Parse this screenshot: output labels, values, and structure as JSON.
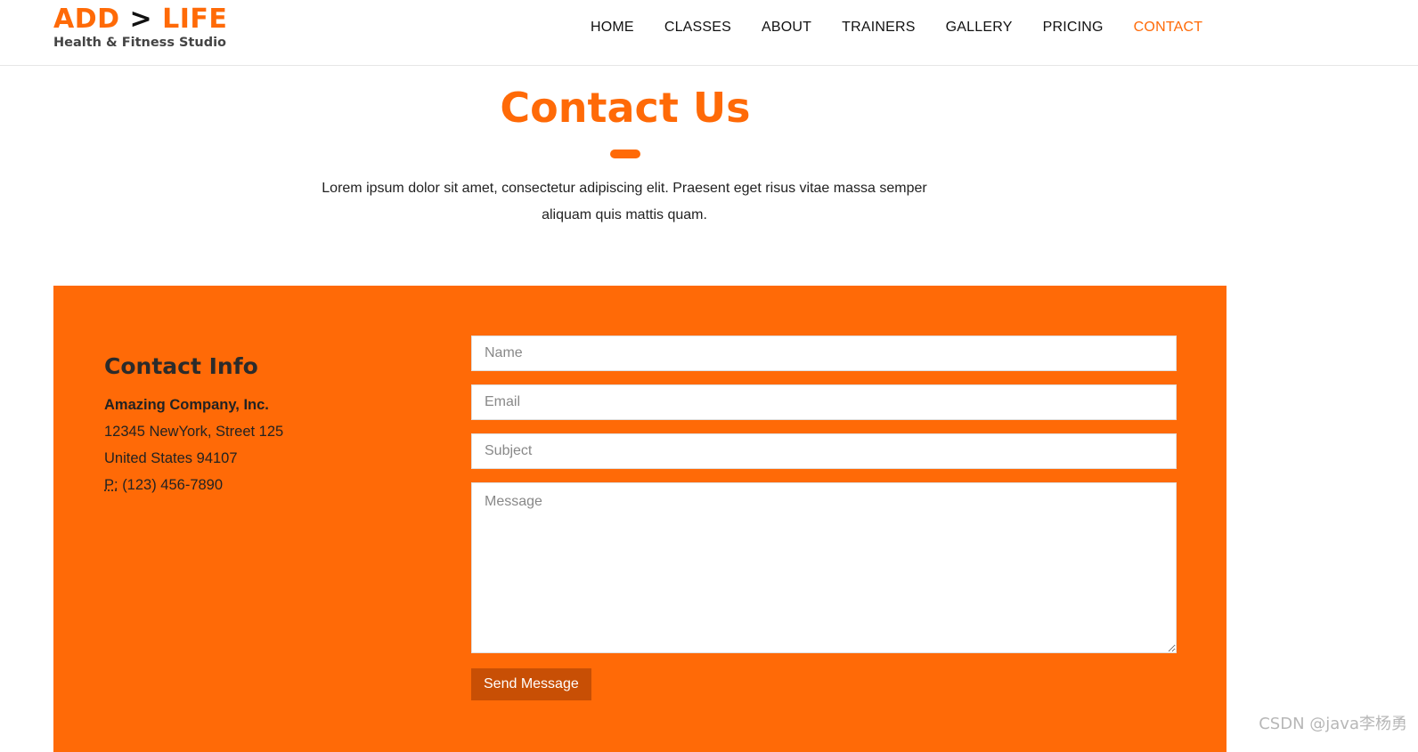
{
  "logo": {
    "part1": "ADD",
    "arrow": ">",
    "part2": "LIFE",
    "subtitle": "Health & Fitness Studio"
  },
  "nav": {
    "items": [
      {
        "label": "HOME"
      },
      {
        "label": "CLASSES"
      },
      {
        "label": "ABOUT"
      },
      {
        "label": "TRAINERS"
      },
      {
        "label": "GALLERY"
      },
      {
        "label": "PRICING"
      },
      {
        "label": "CONTACT",
        "active": true
      }
    ]
  },
  "hero": {
    "title": "Contact Us",
    "text": "Lorem ipsum dolor sit amet, consectetur adipiscing elit. Praesent eget risus vitae massa semper aliquam quis mattis quam."
  },
  "contact_info": {
    "title": "Contact Info",
    "company": "Amazing Company, Inc.",
    "address_line1": "12345 NewYork, Street 125",
    "address_line2": "United States 94107",
    "phone_label": "P:",
    "phone": "(123) 456-7890"
  },
  "form": {
    "name_placeholder": "Name",
    "email_placeholder": "Email",
    "subject_placeholder": "Subject",
    "message_placeholder": "Message",
    "send_label": "Send Message"
  },
  "watermark": "CSDN @java李杨勇",
  "colors": {
    "accent": "#ff6a07",
    "button": "#c84f05"
  }
}
